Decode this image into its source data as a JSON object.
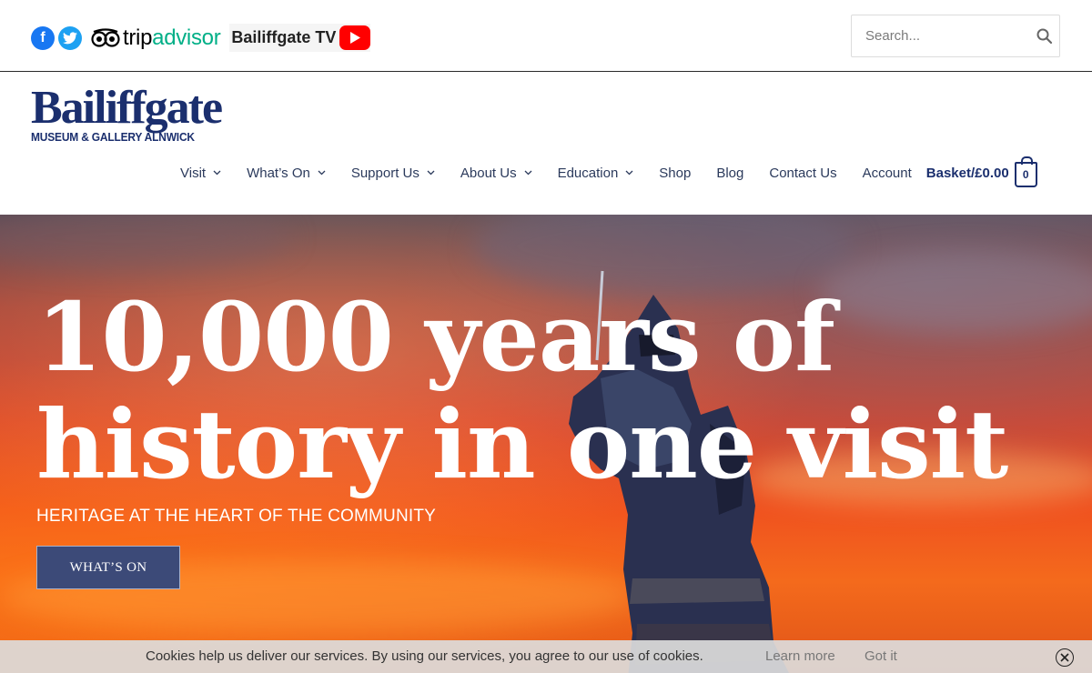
{
  "topbar": {
    "tripadvisor": {
      "trip": "trip",
      "advisor": "advisor"
    },
    "bailiffgate_tv": "Bailiffgate TV",
    "search": {
      "placeholder": "Search..."
    }
  },
  "logo": {
    "main": "Bailiffgate",
    "sub": "MUSEUM & GALLERY ALNWICK"
  },
  "nav": {
    "items": [
      {
        "label": "Visit",
        "dropdown": true
      },
      {
        "label": "What’s On",
        "dropdown": true
      },
      {
        "label": "Support Us",
        "dropdown": true
      },
      {
        "label": "About Us",
        "dropdown": true
      },
      {
        "label": "Education",
        "dropdown": true
      },
      {
        "label": "Shop",
        "dropdown": false
      },
      {
        "label": "Blog",
        "dropdown": false
      },
      {
        "label": "Contact Us",
        "dropdown": false
      },
      {
        "label": "Account",
        "dropdown": false
      }
    ],
    "basket_label": "Basket/£0.00",
    "basket_count": "0"
  },
  "hero": {
    "title_line1": "10,000 years of",
    "title_line2": "history in one visit",
    "subtitle": "HERITAGE AT THE HEART OF THE COMMUNITY",
    "button": "WHAT’S ON"
  },
  "cookie": {
    "text": "Cookies help us deliver our services. By using our services, you agree to our use of cookies.",
    "learn_more": "Learn more",
    "got_it": "Got it"
  },
  "colors": {
    "brand_navy": "#1b2f6e",
    "facebook": "#1877f2",
    "twitter": "#1da1f2",
    "tripadvisor_green": "#00af87",
    "youtube": "#ff0000",
    "button_bg": "#3c4a78"
  },
  "icons": [
    "facebook-icon",
    "twitter-icon",
    "tripadvisor-owl-icon",
    "youtube-icon",
    "search-icon",
    "chevron-down-icon",
    "basket-icon",
    "close-icon"
  ]
}
